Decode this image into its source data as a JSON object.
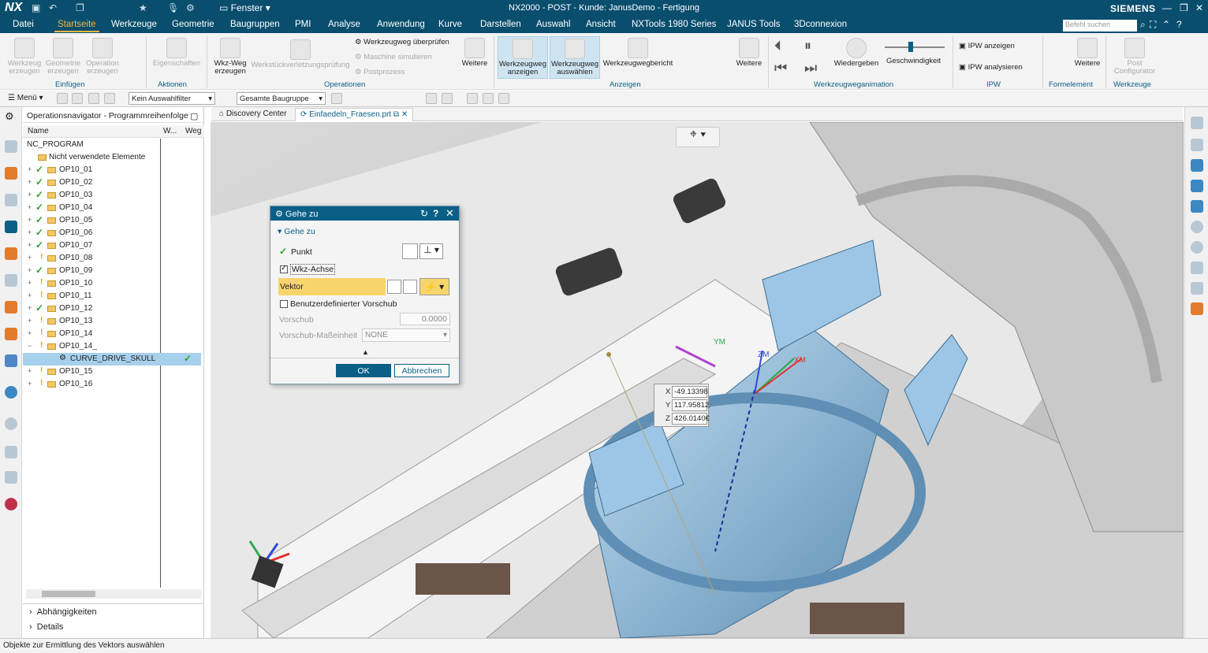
{
  "titlebar": {
    "logo": "NX",
    "title": "NX2000 - POST - Kunde: JanusDemo - Fertigung",
    "brand": "SIEMENS",
    "window_menu": "Fenster"
  },
  "menubar": {
    "items": [
      "Datei",
      "Startseite",
      "Werkzeuge",
      "Geometrie",
      "Baugruppen",
      "PMI",
      "Analyse",
      "Anwendung",
      "Kurve",
      "Darstellen",
      "Auswahl",
      "Ansicht",
      "NXTools 1980 Series",
      "JANUS Tools",
      "3Dconnexion"
    ],
    "active": "Startseite",
    "search_placeholder": "Befehl suchen"
  },
  "ribbon": {
    "einfuegen": {
      "group": "Einfügen",
      "b1": "Werkzeug erzeugen",
      "b2": "Geometrie erzeugen",
      "b3": "Operation erzeugen"
    },
    "aktionen": {
      "group": "Aktionen",
      "b1": "Eigenschaften"
    },
    "operationen": {
      "group": "Operationen",
      "b1": "Wkz-Weg erzeugen",
      "b2": "Werkstückverletzungsprüfung",
      "s1": "Werkzeugweg überprüfen",
      "s2": "Maschine simulieren",
      "s3": "Postprozess",
      "more": "Weitere"
    },
    "anzeigen": {
      "group": "Anzeigen",
      "b1": "Werkzeugweg anzeigen",
      "b2": "Werkzeugweg auswählen",
      "b3": "Werkzeugwegbericht",
      "more": "Weitere"
    },
    "animation": {
      "group": "Werkzeugweganimation",
      "play": "Wiedergeben",
      "speed": "Geschwindigkeit"
    },
    "ipw": {
      "group": "IPW",
      "s1": "IPW anzeigen",
      "s2": "IPW analysieren"
    },
    "formel": {
      "group": "Formelement",
      "more": "Weitere"
    },
    "wzg": {
      "group": "Werkzeuge",
      "b1": "Post Configurator"
    }
  },
  "toolbar": {
    "menu": "Menü",
    "filter": "Kein Auswahlfilter",
    "assembly": "Gesamte Baugruppe"
  },
  "navigator": {
    "title": "Operationsnavigator - Programmreihenfolge",
    "col_name": "Name",
    "col_w": "W...",
    "col_weg": "Weg",
    "root": "NC_PROGRAM",
    "unused": "Nicht verwendete Elemente",
    "ops": [
      {
        "name": "OP10_01",
        "status": "ok"
      },
      {
        "name": "OP10_02",
        "status": "ok"
      },
      {
        "name": "OP10_03",
        "status": "ok"
      },
      {
        "name": "OP10_04",
        "status": "ok"
      },
      {
        "name": "OP10_05",
        "status": "ok"
      },
      {
        "name": "OP10_06",
        "status": "ok"
      },
      {
        "name": "OP10_07",
        "status": "ok"
      },
      {
        "name": "OP10_08",
        "status": "warn"
      },
      {
        "name": "OP10_09",
        "status": "ok"
      },
      {
        "name": "OP10_10",
        "status": "warn"
      },
      {
        "name": "OP10_11",
        "status": "warn"
      },
      {
        "name": "OP10_12",
        "status": "ok"
      },
      {
        "name": "OP10_13",
        "status": "warn"
      },
      {
        "name": "OP10_14",
        "status": "warn"
      },
      {
        "name": "OP10_14_",
        "status": "warn"
      },
      {
        "name": "OP10_15",
        "status": "warn"
      },
      {
        "name": "OP10_16",
        "status": "warn"
      }
    ],
    "selected_child": "CURVE_DRIVE_SKULL",
    "footer1": "Abhängigkeiten",
    "footer2": "Details"
  },
  "tabs": {
    "t1": "Discovery Center",
    "t2": "Einfaedeln_Fraesen.prt"
  },
  "dialog": {
    "title": "Gehe zu",
    "section": "Gehe zu",
    "punkt": "Punkt",
    "wkz_achse": "Wkz-Achse",
    "vektor": "Vektor",
    "custom_feed": "Benutzerdefinierter Vorschub",
    "vorschub": "Vorschub",
    "vorschub_value": "0.0000",
    "unit_label": "Vorschub-Maßeinheit",
    "unit_value": "NONE",
    "ok": "OK",
    "cancel": "Abbrechen"
  },
  "coords": {
    "x": "-49.13398",
    "y": "117.95812",
    "z": "426.0140€"
  },
  "axis_labels": {
    "x": "XM",
    "y": "YM",
    "z": "ZM"
  },
  "status": "Objekte zur Ermittlung des Vektors auswählen",
  "colors": {
    "titlebar": "#0a4e6e",
    "accent": "#f5b642",
    "dialog_head": "#0a5f86",
    "part": "#9dc6e6",
    "highlight": "#f7d56a"
  }
}
